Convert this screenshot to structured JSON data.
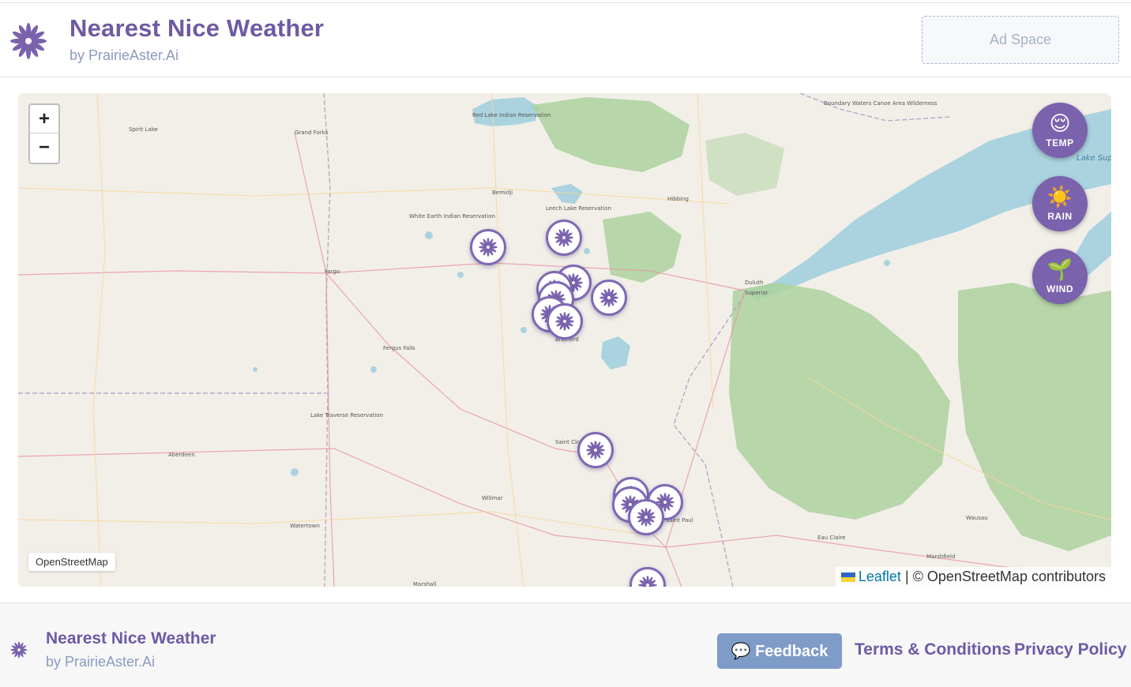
{
  "header": {
    "title": "Nearest Nice Weather",
    "subtitle": "by PrairieAster.Ai",
    "ad_label": "Ad Space"
  },
  "map": {
    "zoom_in": "+",
    "zoom_out": "−",
    "layer_label": "OpenStreetMap",
    "attribution_link": "Leaflet",
    "attribution_text": " | © OpenStreetMap contributors",
    "place_labels": [
      "Red Lake Indian Reservation",
      "Grand Forks",
      "Bemidji",
      "Leech Lake Reservation",
      "White Earth Indian Reservation",
      "Hibbing",
      "Duluth",
      "Superior",
      "Fargo",
      "Fergus Falls",
      "Brainerd",
      "Saint Cloud",
      "Willmar",
      "Watertown",
      "Aberdeen",
      "Marshall",
      "Saint Paul",
      "Eau Claire",
      "Marshfield",
      "Wausau",
      "Lake Superior",
      "Boundary Waters Canoe Area Wilderness",
      "Lake Traverse Reservation"
    ],
    "controls": [
      {
        "label": "TEMP",
        "emoji": "😌",
        "icon": "relieved-face-icon"
      },
      {
        "label": "RAIN",
        "emoji": "☀️",
        "icon": "sun-icon"
      },
      {
        "label": "WIND",
        "emoji": "🌱",
        "icon": "seedling-icon"
      }
    ],
    "accent": "#7a62ad"
  },
  "footer": {
    "title": "Nearest Nice Weather",
    "subtitle": "by PrairieAster.Ai",
    "feedback_label": "💬 Feedback",
    "terms_label": "Terms & Conditions",
    "privacy_label": "Privacy Policy"
  }
}
